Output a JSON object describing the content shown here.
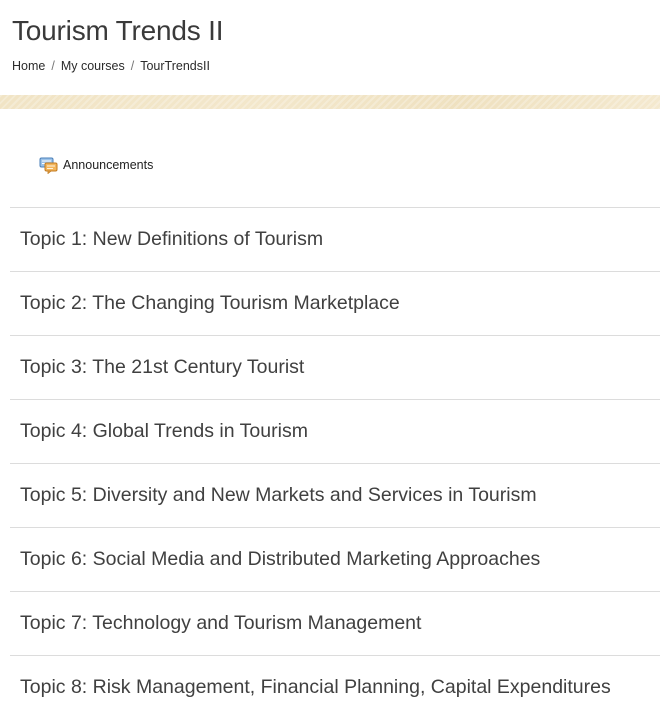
{
  "header": {
    "title": "Tourism Trends II"
  },
  "breadcrumb": {
    "items": [
      "Home",
      "My courses",
      "TourTrendsII"
    ],
    "separator": "/"
  },
  "forum": {
    "label": "Announcements",
    "icon": "forum-icon"
  },
  "topics": [
    "Topic 1: New Definitions of Tourism",
    "Topic 2: The Changing Tourism Marketplace",
    "Topic 3: The 21st Century Tourist",
    "Topic 4: Global Trends in Tourism",
    "Topic 5: Diversity and New Markets and Services in Tourism",
    "Topic 6: Social Media and Distributed Marketing Approaches",
    "Topic 7: Technology and Tourism Management",
    "Topic 8: Risk Management, Financial Planning, Capital Expenditures"
  ],
  "colors": {
    "band": "#f1e4c5",
    "divider": "#dcdcdc",
    "text": "#404040"
  }
}
